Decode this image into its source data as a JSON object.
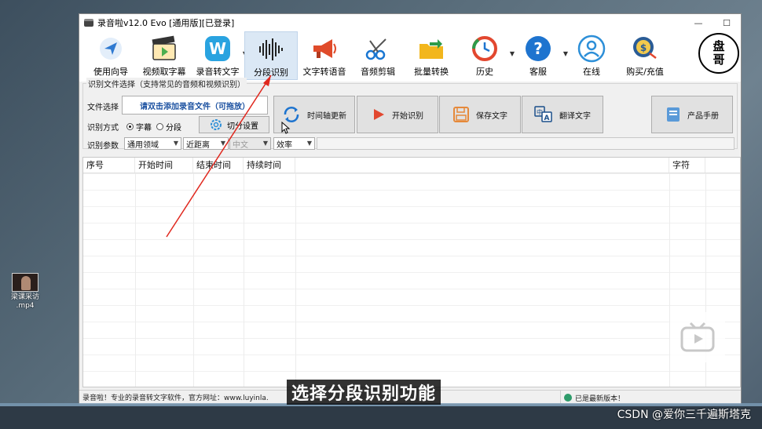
{
  "desktop": {
    "file_name_line1": "梁课采访",
    "file_name_line2": ".mp4"
  },
  "window": {
    "title": "录音啦v12.0 Evo [通用版][已登录]",
    "controls": {
      "minimize": "—",
      "maximize": "☐"
    }
  },
  "toolbar": {
    "items": [
      {
        "label": "使用向导",
        "icon": "navigator-icon",
        "color": "#2f7ad1"
      },
      {
        "label": "视频取字幕",
        "icon": "video-subtitle-icon",
        "color": "#4caf50"
      },
      {
        "label": "录音转文字",
        "icon": "w-logo-icon",
        "color": "#29a3e0"
      },
      {
        "label": "分段识别",
        "icon": "waveform-icon",
        "color": "#222222",
        "active": true
      },
      {
        "label": "文字转语音",
        "icon": "megaphone-icon",
        "color": "#e04b2a"
      },
      {
        "label": "音频剪辑",
        "icon": "scissors-icon",
        "color": "#1976d2"
      },
      {
        "label": "批量转换",
        "icon": "folder-convert-icon",
        "color": "#f2b61c"
      },
      {
        "label": "历史",
        "icon": "history-icon",
        "color": "#e2472f"
      },
      {
        "label": "客服",
        "icon": "help-icon",
        "color": "#1e74cf"
      },
      {
        "label": "在线",
        "icon": "user-online-icon",
        "color": "#2d8fd8"
      },
      {
        "label": "购买/充值",
        "icon": "coin-purchase-icon",
        "color": "#2a5c96"
      }
    ],
    "logo_line1": "盘",
    "logo_line2": "哥"
  },
  "form": {
    "group_title": "识别文件选择（支持常见的音频和视频识别）",
    "file_label": "文件选择",
    "file_button": "请双击添加录音文件（可拖放）",
    "mode_label": "识别方式",
    "mode_options": [
      "字幕",
      "分段"
    ],
    "mode_selected": "字幕",
    "split_settings": "切分设置",
    "params_label": "识别参数",
    "param_domain": "通用领域",
    "param_distance": "近距离",
    "param_language": "中文",
    "param_efficiency": "效率",
    "buttons": {
      "timeline_update": "时间轴更新",
      "start_recognition": "开始识别",
      "save_text": "保存文字",
      "translate_text": "翻译文字",
      "product_manual": "产品手册"
    }
  },
  "table": {
    "columns": [
      "序号",
      "开始时间",
      "结束时间",
      "持续时间",
      "",
      "字符",
      ""
    ]
  },
  "status": {
    "left_text": "录音啦！专业的录音转文字软件，官方网址：www.luyinla.",
    "right_text": "已是最新版本！"
  },
  "overlay": {
    "subtitle": "选择分段识别功能",
    "watermark": "CSDN @爱你三千遍斯塔克"
  }
}
